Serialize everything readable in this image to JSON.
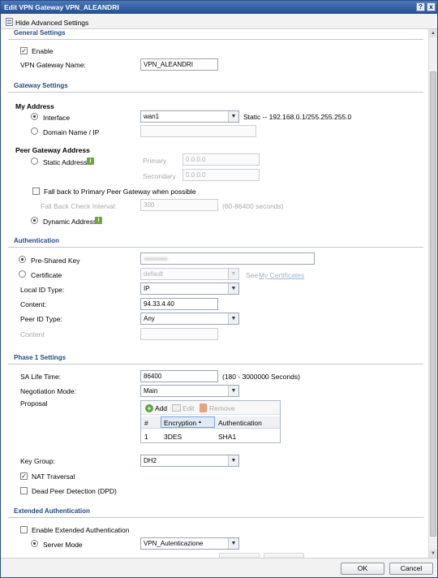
{
  "window": {
    "title": "Edit VPN Gateway VPN_ALEANDRI",
    "help_label": "?",
    "close_label": "x"
  },
  "toolbar": {
    "advanced_toggle": "Hide Advanced Settings"
  },
  "general": {
    "heading": "General Settings",
    "enable_label": "Enable",
    "enable_checked": true,
    "name_label": "VPN Gateway Name:",
    "name_value": "VPN_ALEANDRI"
  },
  "gateway": {
    "heading": "Gateway Settings",
    "my_address": "My Address",
    "interface_label": "Interface",
    "interface_value": "wan1",
    "interface_info": "Static -- 192.168.0.1/255.255.255.0",
    "domain_label": "Domain Name / IP",
    "peer_address": "Peer Gateway Address",
    "static_label": "Static Address",
    "primary_label": "Primary",
    "primary_value": "0.0.0.0",
    "secondary_label": "Secondary",
    "secondary_value": "0.0.0.0",
    "fallback_label": "Fall back to Primary Peer Gateway when possible",
    "fallback_interval_label": "Fall Back Check Interval:",
    "fallback_interval_value": "300",
    "fallback_interval_hint": "(60-86400 seconds)",
    "dynamic_label": "Dynamic Address",
    "info_icon_glyph": "i"
  },
  "auth": {
    "heading": "Authentication",
    "psk_label": "Pre-Shared Key",
    "cert_label": "Certificate",
    "cert_value": "default",
    "cert_link_prefix": "See",
    "cert_link": "My Certificates",
    "local_id_label": "Local ID Type:",
    "local_id_value": "IP",
    "content_label": "Content:",
    "content_value": "94.33.4.40",
    "peer_id_label": "Peer ID Type:",
    "peer_id_value": "Any",
    "peer_content_label": "Content"
  },
  "phase1": {
    "heading": "Phase 1 Settings",
    "sa_life_label": "SA Life Time:",
    "sa_life_value": "86400",
    "sa_life_hint": "(180 - 3000000 Seconds)",
    "negotiation_label": "Negotiation Mode:",
    "negotiation_value": "Main",
    "proposal_label": "Proposal",
    "add_label": "Add",
    "edit_label": "Edit",
    "remove_label": "Remove",
    "columns": [
      "#",
      "Encryption",
      "Authentication"
    ],
    "rows": [
      {
        "num": "1",
        "encryption": "3DES",
        "authentication": "SHA1"
      }
    ],
    "key_group_label": "Key Group:",
    "key_group_value": "DH2",
    "nat_label": "NAT Traversal",
    "nat_checked": true,
    "dpd_label": "Dead Peer Detection (DPD)",
    "dpd_checked": false
  },
  "extauth": {
    "heading": "Extended Authentication",
    "enable_label": "Enable Extended Authentication",
    "server_label": "Server Mode",
    "server_value": "VPN_Autenticazione"
  },
  "footer": {
    "ok_label": "OK",
    "cancel_label": "Cancel"
  },
  "icons": {
    "dropdown": "▼",
    "check": "✓",
    "sort_up": "▲",
    "scroll_up": "▲",
    "scroll_down": "▼"
  },
  "colors": {
    "title_bar": "#2f5b9e",
    "section_heading": "#1e4a8c",
    "info_badge": "#6fa73b",
    "link": "#9fb3d1"
  }
}
